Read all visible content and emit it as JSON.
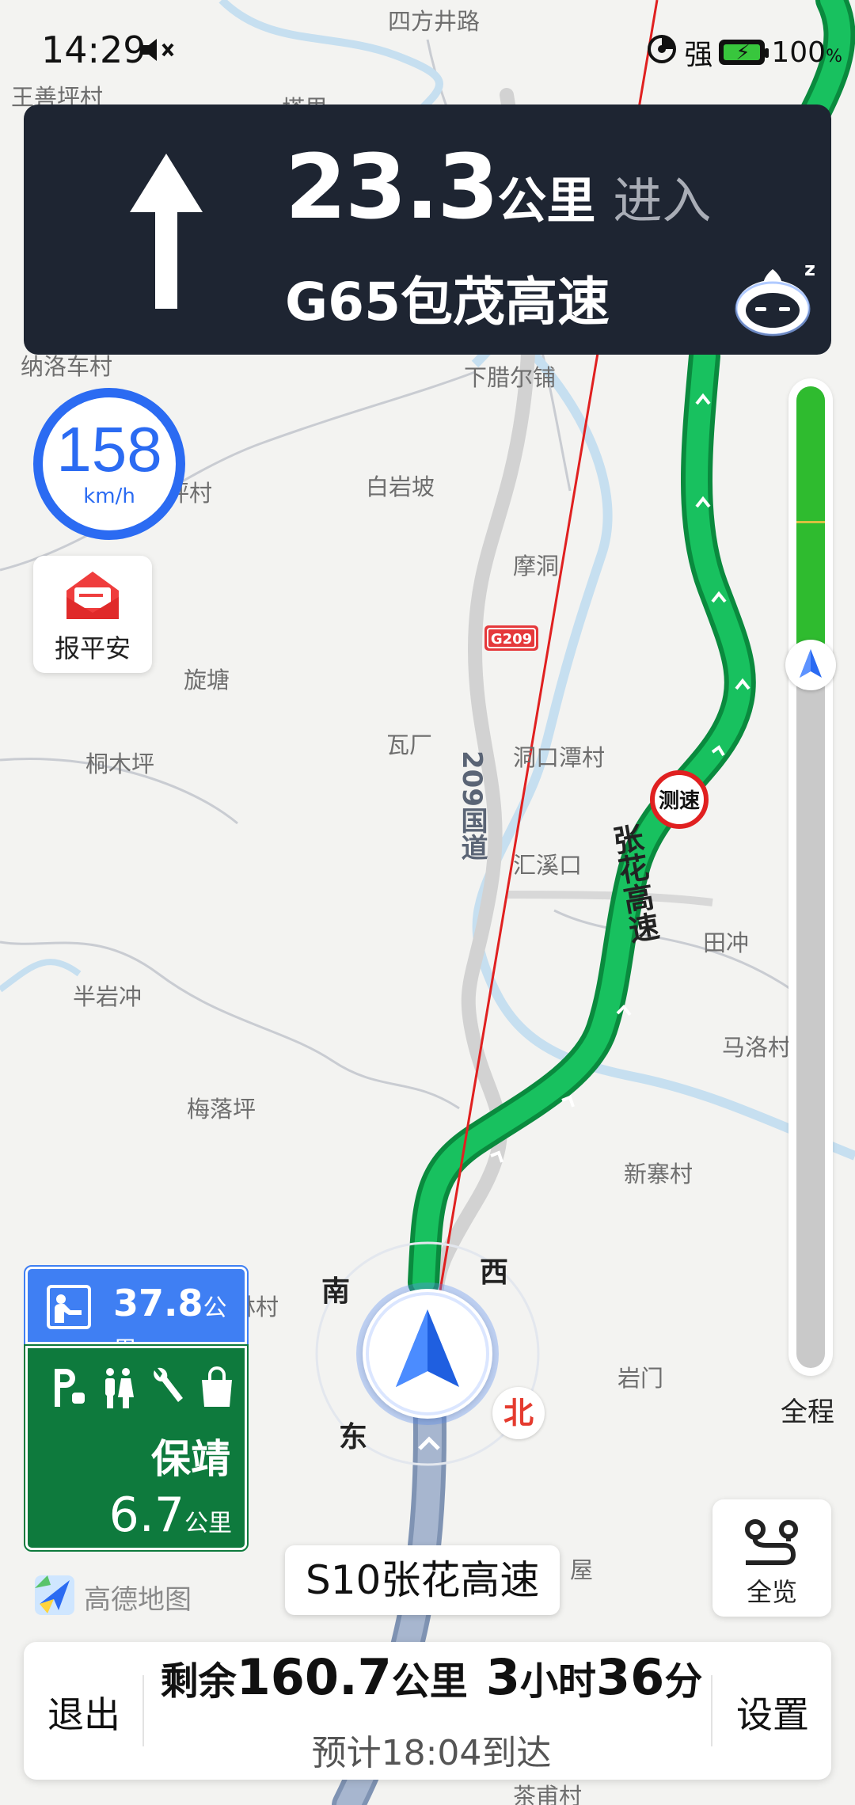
{
  "status_bar": {
    "time": "14:29",
    "signal_text": "强",
    "battery_pct": "100",
    "battery_unit": "%"
  },
  "guide": {
    "distance": "23.3",
    "distance_unit": "公里",
    "action": "进入",
    "road": "G65包茂高速",
    "arrow_icon": "straight-arrow-icon",
    "assistant_icon": "sleeping-robot-icon"
  },
  "speed": {
    "value": "158",
    "unit": "km/h",
    "color": "#2b6bf2"
  },
  "safe_report": {
    "label": "报平安"
  },
  "map": {
    "labels": [
      "王善坪村",
      "四方井路",
      "塔里",
      "纳洛车村",
      "下腊尔铺",
      "白岩坡",
      "坪村",
      "摩洞",
      "旋塘",
      "瓦厂",
      "洞口潭村",
      "桐木坪",
      "汇溪口",
      "田冲",
      "半岩冲",
      "马洛村",
      "梅落坪",
      "新寨村",
      "岩门",
      "林村",
      "屋",
      "茶甫村"
    ],
    "national_road_shield": "G209",
    "national_road_name": "209国道",
    "highway_name": "张花高速",
    "speed_camera": "测速"
  },
  "progress": {
    "label": "全程",
    "traveled_fraction": 0.21,
    "green_color": "#2fbb2f"
  },
  "service_area": {
    "next_distance": "37.8",
    "next_unit": "公里",
    "name": "保靖",
    "distance": "6.7",
    "unit": "公里",
    "facility_icons": [
      "parking-icon",
      "restroom-icon",
      "repair-icon",
      "shop-icon"
    ]
  },
  "compass": {
    "south": "南",
    "west": "西",
    "east": "东",
    "north": "北"
  },
  "current_road": "S10张花高速",
  "logo_text": "高德地图",
  "overview": {
    "label": "全览"
  },
  "bottom_bar": {
    "exit_label": "退出",
    "remaining_label": "剩余",
    "remaining_distance": "160.7",
    "distance_unit": "公里",
    "hours": "3",
    "hours_unit": "小时",
    "minutes": "36",
    "minutes_unit": "分",
    "eta": "预计18:04到达",
    "settings_label": "设置"
  }
}
